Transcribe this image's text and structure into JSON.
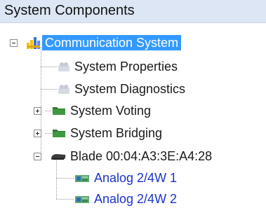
{
  "panel": {
    "title": "System Components"
  },
  "tree": {
    "root": {
      "label": "Communication System",
      "expanded": true,
      "selected": true,
      "icon": "network-system-icon"
    },
    "items": [
      {
        "label": "System Properties",
        "icon": "properties-icon"
      },
      {
        "label": "System Diagnostics",
        "icon": "diagnostics-icon"
      },
      {
        "label": "System Voting",
        "icon": "folder-icon",
        "expanded": false
      },
      {
        "label": "System Bridging",
        "icon": "folder-icon",
        "expanded": false
      },
      {
        "label": "Blade 00:04:A3:3E:A4:28",
        "icon": "blade-icon",
        "expanded": true,
        "children": [
          {
            "label": "Analog 2/4W 1",
            "icon": "analog-card-icon"
          },
          {
            "label": "Analog 2/4W 2",
            "icon": "analog-card-icon"
          }
        ]
      }
    ]
  },
  "colors": {
    "header_bg": "#dce6f4",
    "selection": "#3399ff",
    "link": "#1a33cc"
  }
}
